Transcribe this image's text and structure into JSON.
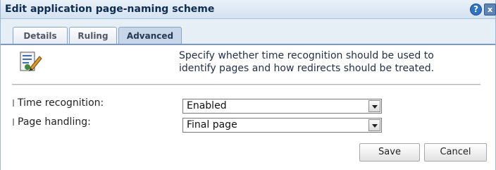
{
  "dialog": {
    "title": "Edit application page-naming scheme",
    "help_label": "?",
    "close_label": "x"
  },
  "tabs": [
    {
      "label": "Details",
      "active": false
    },
    {
      "label": "Ruling",
      "active": false
    },
    {
      "label": "Advanced",
      "active": true
    }
  ],
  "content": {
    "icon": "edit-document-icon",
    "description_line1": "Specify whether time recognition should be used to",
    "description_line2": "identify pages and how redirects should be treated."
  },
  "form": {
    "time_recognition_label": "Time recognition:",
    "time_recognition_value": "Enabled",
    "page_handling_label": "Page handling:",
    "page_handling_value": "Final page"
  },
  "buttons": {
    "save_label": "Save",
    "cancel_label": "Cancel"
  },
  "colors": {
    "titlebar": "#d4e2f1",
    "active_tab": "#c7d7e9",
    "title_text": "#0f2d52"
  }
}
